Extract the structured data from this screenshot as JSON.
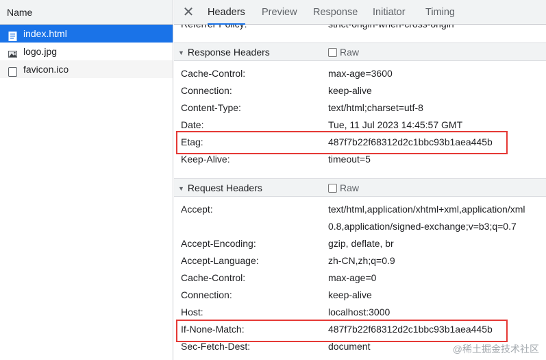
{
  "left_panel": {
    "header": "Name",
    "files": [
      {
        "name": "index.html",
        "icon": "document-icon"
      },
      {
        "name": "logo.jpg",
        "icon": "image-icon"
      },
      {
        "name": "favicon.ico",
        "icon": "blank-file-icon"
      }
    ]
  },
  "tabs": [
    "Headers",
    "Preview",
    "Response",
    "Initiator",
    "Timing"
  ],
  "partial_row": {
    "name": "Referrer Policy:",
    "value": "strict-origin-when-cross-origin"
  },
  "response_headers": {
    "title": "Response Headers",
    "raw_label": "Raw",
    "rows": [
      {
        "name": "Cache-Control:",
        "value": "max-age=3600"
      },
      {
        "name": "Connection:",
        "value": "keep-alive"
      },
      {
        "name": "Content-Type:",
        "value": "text/html;charset=utf-8"
      },
      {
        "name": "Date:",
        "value": "Tue, 11 Jul 2023 14:45:57 GMT"
      },
      {
        "name": "Etag:",
        "value": "487f7b22f68312d2c1bbc93b1aea445b"
      },
      {
        "name": "Keep-Alive:",
        "value": "timeout=5"
      }
    ]
  },
  "request_headers": {
    "title": "Request Headers",
    "raw_label": "Raw",
    "rows": [
      {
        "name": "Accept:",
        "value": "text/html,application/xhtml+xml,application/xml"
      },
      {
        "name": "",
        "value": "0.8,application/signed-exchange;v=b3;q=0.7"
      },
      {
        "name": "Accept-Encoding:",
        "value": "gzip, deflate, br"
      },
      {
        "name": "Accept-Language:",
        "value": "zh-CN,zh;q=0.9"
      },
      {
        "name": "Cache-Control:",
        "value": "max-age=0"
      },
      {
        "name": "Connection:",
        "value": "keep-alive"
      },
      {
        "name": "Host:",
        "value": "localhost:3000"
      },
      {
        "name": "If-None-Match:",
        "value": "487f7b22f68312d2c1bbc93b1aea445b"
      },
      {
        "name": "Sec-Fetch-Dest:",
        "value": "document"
      }
    ]
  },
  "watermark": "@稀土掘金技术社区",
  "colors": {
    "selected": "#1a73e8",
    "highlight": "#e53935",
    "panel_bg": "#f1f3f4"
  }
}
